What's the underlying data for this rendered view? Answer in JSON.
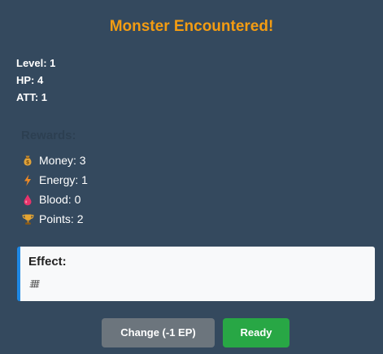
{
  "header": {
    "title": "Monster Encountered!"
  },
  "monster": {
    "level": "Level: 1",
    "hp": "HP: 4",
    "att": "ATT: 1"
  },
  "rewards": {
    "title": "Rewards:",
    "items": [
      {
        "label": "Money: 3",
        "icon": "money-bag-icon"
      },
      {
        "label": "Energy: 1",
        "icon": "lightning-icon"
      },
      {
        "label": "Blood: 0",
        "icon": "blood-drop-icon"
      },
      {
        "label": "Points: 2",
        "icon": "trophy-icon"
      }
    ]
  },
  "effect": {
    "title": "Effect:",
    "icon": "effect-glyph-icon"
  },
  "actions": {
    "change_label": "Change (-1 EP)",
    "ready_label": "Ready"
  },
  "colors": {
    "background": "#34495e",
    "title": "#f39c12",
    "effect_border": "#1e88e5",
    "change_button": "#6c757d",
    "ready_button": "#28a745"
  }
}
